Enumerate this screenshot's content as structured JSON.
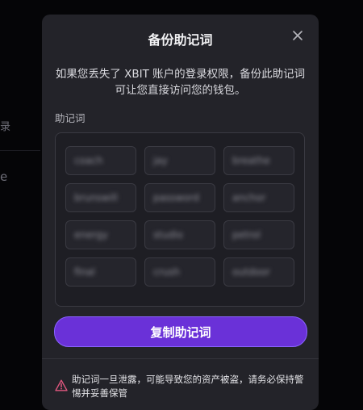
{
  "background": {
    "left_text_1": "录",
    "left_text_2": "e"
  },
  "modal": {
    "title": "备份助记词",
    "description": "如果您丢失了 XBIT 账户的登录权限，备份此助记词可让您直接访问您的钱包。",
    "mnemonic_label": "助记词",
    "words": [
      "coach",
      "jay",
      "breathe",
      "brunswill",
      "password",
      "anchor",
      "energy",
      "studio",
      "petrol",
      "final",
      "crush",
      "outdoor"
    ],
    "copy_button_label": "复制助记词",
    "warning_text": "助记词一旦泄露，可能导致您的资产被盗，请务必保持警惕并妥善保管",
    "icons": {
      "close": "close-icon",
      "warning": "warning-triangle-icon"
    },
    "colors": {
      "accent": "#6a31d8",
      "warning": "#e0577f",
      "surface": "#232329"
    }
  }
}
